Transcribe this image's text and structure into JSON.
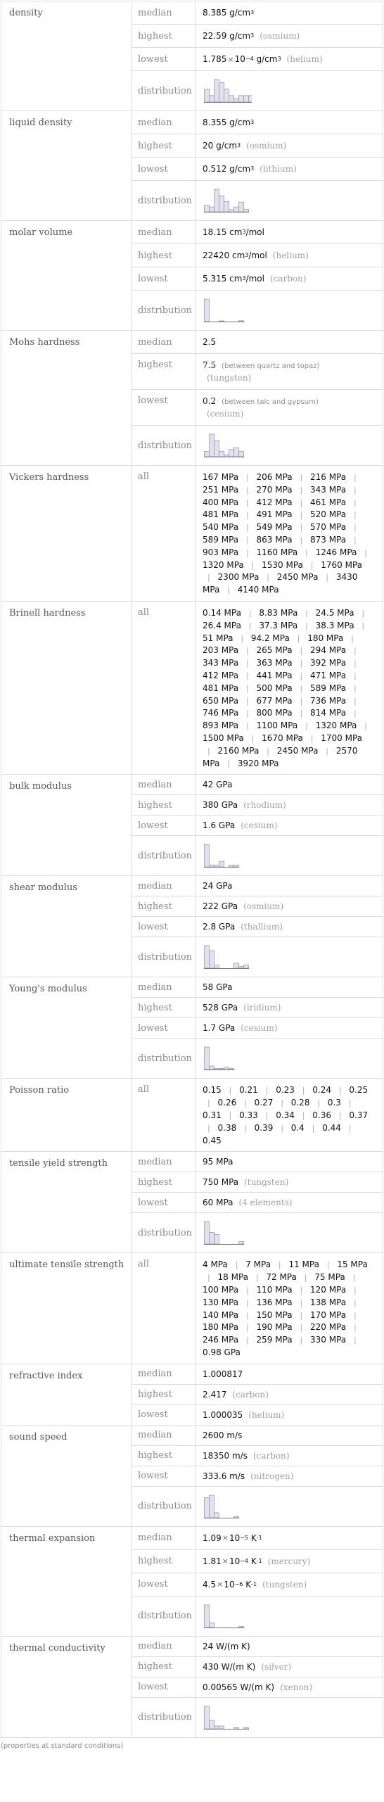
{
  "rows": [
    {
      "property": "density",
      "stats": [
        {
          "label": "median",
          "value": "8.385 g/cm",
          "sup": "3"
        },
        {
          "label": "highest",
          "value": "22.59 g/cm",
          "sup": "3",
          "note": "(osmium)"
        },
        {
          "label": "lowest",
          "mant": "1.785",
          "exp": "−4",
          "value": "g/cm",
          "sup": "3",
          "note": "(helium)"
        },
        {
          "label": "distribution",
          "hist": [
            4,
            2,
            7,
            6,
            4,
            2,
            1,
            2,
            2,
            2
          ]
        }
      ]
    },
    {
      "property": "liquid density",
      "stats": [
        {
          "label": "median",
          "value": "8.355 g/cm",
          "sup": "3"
        },
        {
          "label": "highest",
          "value": "20 g/cm",
          "sup": "3",
          "note": "(osmium)"
        },
        {
          "label": "lowest",
          "value": "0.512 g/cm",
          "sup": "3",
          "note": "(lithium)"
        },
        {
          "label": "distribution",
          "hist": [
            2,
            1.5,
            7,
            5,
            3.2,
            0.7,
            1.5,
            3,
            0.8
          ]
        }
      ]
    },
    {
      "property": "molar volume",
      "stats": [
        {
          "label": "median",
          "value": "18.15 cm",
          "sup": "3",
          "tail": "/mol"
        },
        {
          "label": "highest",
          "value": "22420 cm",
          "sup": "3",
          "tail": "/mol",
          "note": "(helium)"
        },
        {
          "label": "lowest",
          "value": "5.315 cm",
          "sup": "3",
          "tail": "/mol",
          "note": "(carbon)"
        },
        {
          "label": "distribution",
          "hist": [
            13,
            0,
            0,
            0.3,
            0,
            0,
            0,
            0.5
          ]
        }
      ]
    },
    {
      "property": "Mohs hardness",
      "stats": [
        {
          "label": "median",
          "value": "2.5"
        },
        {
          "label": "highest",
          "value": "7.5",
          "qual": "(between quartz and topaz)",
          "note2": "(tungsten)"
        },
        {
          "label": "lowest",
          "value": "0.2",
          "qual": "(between talc and gypsum)",
          "note2": "(cesium)"
        },
        {
          "label": "distribution",
          "hist": [
            3,
            12.5,
            9,
            3,
            1,
            4,
            5,
            3
          ]
        }
      ]
    },
    {
      "property": "Vickers hardness",
      "stats": [
        {
          "label": "all",
          "list": [
            "167 MPa",
            "206 MPa",
            "216 MPa",
            "251 MPa",
            "270 MPa",
            "343 MPa",
            "400 MPa",
            "412 MPa",
            "461 MPa",
            "481 MPa",
            "491 MPa",
            "520 MPa",
            "540 MPa",
            "549 MPa",
            "570 MPa",
            "589 MPa",
            "863 MPa",
            "873 MPa",
            "903 MPa",
            "1160 MPa",
            "1246 MPa",
            "1320 MPa",
            "1530 MPa",
            "1760 MPa",
            "2300 MPa",
            "2450 MPa",
            "3430 MPa",
            "4140 MPa"
          ]
        }
      ]
    },
    {
      "property": "Brinell hardness",
      "stats": [
        {
          "label": "all",
          "list": [
            "0.14 MPa",
            "8.83 MPa",
            "24.5 MPa",
            "26.4 MPa",
            "37.3 MPa",
            "38.3 MPa",
            "51 MPa",
            "94.2 MPa",
            "180 MPa",
            "203 MPa",
            "265 MPa",
            "294 MPa",
            "343 MPa",
            "363 MPa",
            "392 MPa",
            "412 MPa",
            "441 MPa",
            "471 MPa",
            "481 MPa",
            "500 MPa",
            "589 MPa",
            "650 MPa",
            "677 MPa",
            "736 MPa",
            "746 MPa",
            "800 MPa",
            "814 MPa",
            "893 MPa",
            "1100 MPa",
            "1320 MPa",
            "1500 MPa",
            "1670 MPa",
            "1700 MPa",
            "2160 MPa",
            "2450 MPa",
            "2570 MPa",
            "3920 MPa"
          ]
        }
      ]
    },
    {
      "property": "bulk modulus",
      "stats": [
        {
          "label": "median",
          "value": "42 GPa"
        },
        {
          "label": "highest",
          "value": "380 GPa",
          "note": "(rhodium)"
        },
        {
          "label": "lowest",
          "value": "1.6 GPa",
          "note": "(cesium)"
        },
        {
          "label": "distribution",
          "hist": [
            12,
            1,
            1,
            3,
            0,
            1,
            1
          ]
        }
      ]
    },
    {
      "property": "shear modulus",
      "stats": [
        {
          "label": "median",
          "value": "24 GPa"
        },
        {
          "label": "highest",
          "value": "222 GPa",
          "note": "(osmium)"
        },
        {
          "label": "lowest",
          "value": "2.8 GPa",
          "note": "(thallium)"
        },
        {
          "label": "distribution",
          "hist": [
            9,
            7,
            1.2,
            0,
            0,
            0,
            2,
            0.7,
            1.3
          ]
        }
      ]
    },
    {
      "property": "Young's modulus",
      "stats": [
        {
          "label": "median",
          "value": "58 GPa"
        },
        {
          "label": "highest",
          "value": "528 GPa",
          "note": "(iridium)"
        },
        {
          "label": "lowest",
          "value": "1.7 GPa",
          "note": "(cesium)"
        },
        {
          "label": "distribution",
          "hist": [
            13,
            2,
            0.6,
            0.6,
            1.3,
            0.6
          ]
        }
      ]
    },
    {
      "property": "Poisson ratio",
      "stats": [
        {
          "label": "all",
          "list": [
            "0.15",
            "0.21",
            "0.23",
            "0.24",
            "0.25",
            "0.26",
            "0.27",
            "0.28",
            "0.3",
            "0.31",
            "0.33",
            "0.34",
            "0.36",
            "0.37",
            "0.38",
            "0.39",
            "0.4",
            "0.44",
            "0.45"
          ]
        }
      ]
    },
    {
      "property": "tensile yield strength",
      "stats": [
        {
          "label": "median",
          "value": "95 MPa"
        },
        {
          "label": "highest",
          "value": "750 MPa",
          "note": "(tungsten)"
        },
        {
          "label": "lowest",
          "value": "60 MPa",
          "note": "(4 elements)"
        },
        {
          "label": "distribution",
          "hist": [
            9,
            4.7,
            3.8,
            0,
            0,
            0,
            0,
            1
          ]
        }
      ]
    },
    {
      "property": "ultimate tensile strength",
      "stats": [
        {
          "label": "all",
          "list": [
            "4 MPa",
            "7 MPa",
            "11 MPa",
            "15 MPa",
            "18 MPa",
            "72 MPa",
            "75 MPa",
            "100 MPa",
            "110 MPa",
            "120 MPa",
            "130 MPa",
            "136 MPa",
            "138 MPa",
            "140 MPa",
            "150 MPa",
            "170 MPa",
            "180 MPa",
            "190 MPa",
            "220 MPa",
            "246 MPa",
            "259 MPa",
            "330 MPa",
            "0.98 GPa"
          ]
        }
      ]
    },
    {
      "property": "refractive index",
      "stats": [
        {
          "label": "median",
          "value": "1.000817"
        },
        {
          "label": "highest",
          "value": "2.417",
          "note": "(carbon)"
        },
        {
          "label": "lowest",
          "value": "1.000035",
          "note": "(helium)"
        }
      ]
    },
    {
      "property": "sound speed",
      "stats": [
        {
          "label": "median",
          "value": "2600 m/s"
        },
        {
          "label": "highest",
          "value": "18350 m/s",
          "note": "(carbon)"
        },
        {
          "label": "lowest",
          "value": "333.6 m/s",
          "note": "(nitrogen)"
        },
        {
          "label": "distribution",
          "hist": [
            8,
            9,
            2,
            0,
            0,
            0,
            0.5
          ]
        }
      ]
    },
    {
      "property": "thermal expansion",
      "stats": [
        {
          "label": "median",
          "mant": "1.09",
          "exp": "−5",
          "value": "K",
          "sup": "-1"
        },
        {
          "label": "highest",
          "mant": "1.81",
          "exp": "−4",
          "value": "K",
          "sup": "-1",
          "note": "(mercury)"
        },
        {
          "label": "lowest",
          "mant": "4.5",
          "exp": "−6",
          "value": "K",
          "sup": "-1",
          "note": "(tungsten)"
        },
        {
          "label": "distribution",
          "hist": [
            12,
            2.5,
            0,
            0,
            0,
            0,
            0,
            0.5
          ]
        }
      ]
    },
    {
      "property": "thermal conductivity",
      "stats": [
        {
          "label": "median",
          "value": "24 W/(m K)"
        },
        {
          "label": "highest",
          "value": "430 W/(m K)",
          "note": "(silver)"
        },
        {
          "label": "lowest",
          "value": "0.00565 W/(m K)",
          "note": "(xenon)"
        },
        {
          "label": "distribution",
          "hist": [
            12,
            4.5,
            1.5,
            1.5,
            0,
            0,
            0.6,
            0,
            0.6
          ]
        }
      ]
    }
  ],
  "footer": "(properties at standard conditions)",
  "colors": {
    "bar_fill": "#e1e1f0",
    "bar_stroke": "#9a9aa6",
    "axis": "#777777",
    "border": "#dcdcdc"
  }
}
